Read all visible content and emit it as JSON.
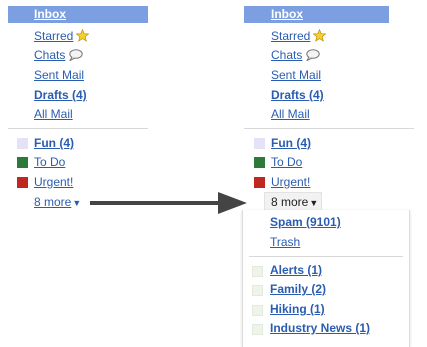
{
  "left": {
    "inbox": "Inbox",
    "starred": "Starred",
    "chats": "Chats",
    "sent": "Sent Mail",
    "drafts": "Drafts (4)",
    "all": "All Mail",
    "labels": [
      {
        "name": "Fun (4)",
        "color": "#e5e2f8"
      },
      {
        "name": "To Do",
        "color": "#2c7a37"
      },
      {
        "name": "Urgent!",
        "color": "#c0281f"
      }
    ],
    "more": "8 more"
  },
  "right": {
    "inbox": "Inbox",
    "starred": "Starred",
    "chats": "Chats",
    "sent": "Sent Mail",
    "drafts": "Drafts (4)",
    "all": "All Mail",
    "labels": [
      {
        "name": "Fun (4)",
        "color": "#e5e2f8"
      },
      {
        "name": "To Do",
        "color": "#2c7a37"
      },
      {
        "name": "Urgent!",
        "color": "#c0281f"
      }
    ],
    "more": "8 more"
  },
  "menu": {
    "spam": "Spam (9101)",
    "trash": "Trash",
    "labels": [
      "Alerts (1)",
      "Family (2)",
      "Hiking (1)",
      "Industry News (1)"
    ]
  },
  "colors": {
    "link": "#2a5db0",
    "inbox_bar": "#7b9fe0",
    "arrow": "#444444",
    "star": "#f6cf2e"
  }
}
